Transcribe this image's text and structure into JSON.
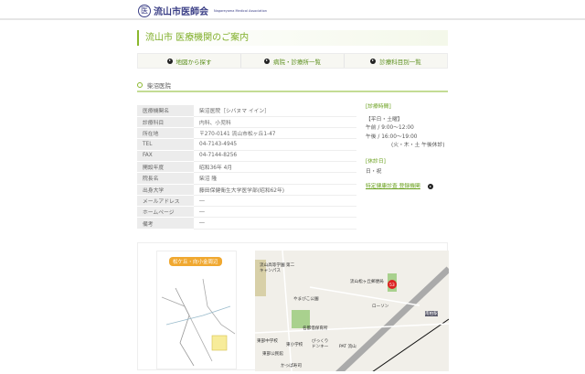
{
  "header": {
    "logo_mark": "医",
    "logo_text": "流山市医師会",
    "logo_sub": "Nagareyama Medical Association"
  },
  "page_title": "流山市 医療機関のご案内",
  "nav": [
    {
      "label": "地図から探す"
    },
    {
      "label": "病院・診療所一覧"
    },
    {
      "label": "診療科目別一覧"
    }
  ],
  "clinic_name": "柴沼医院",
  "details": [
    {
      "k": "医療機関名",
      "v": "柴沼医院［シバヌマ イイン］"
    },
    {
      "k": "診療科目",
      "v": "内科、小児科"
    },
    {
      "k": "所在地",
      "v": "〒270-0141 流山市松ヶ丘1-47"
    },
    {
      "k": "TEL",
      "v": "04-7143-4945"
    },
    {
      "k": "FAX",
      "v": "04-7144-8256"
    },
    {
      "k": "開設年度",
      "v": "昭和36年 4月"
    },
    {
      "k": "院長名",
      "v": "柴沼 隆"
    },
    {
      "k": "出身大学",
      "v": "藤田保健衛生大学医学部(昭和62年)"
    },
    {
      "k": "メールアドレス",
      "v": "―"
    },
    {
      "k": "ホームページ",
      "v": "―"
    },
    {
      "k": "備考",
      "v": "―"
    }
  ],
  "hours": {
    "label": "[診療時間]",
    "days": "【平日・土曜】",
    "am": "午前 / 9:00〜12:00",
    "pm": "午後 / 16:00〜19:00",
    "note": "(火・木・土 午後休診)"
  },
  "holiday": {
    "label": "[休診日]",
    "value": "日・祝"
  },
  "checkup_link": "特定健康診査 登録機関",
  "map": {
    "area_tag": "松ケ丘・向小金周辺",
    "labels": [
      "流山高等学園 第二キャンパス",
      "流山松ヶ丘郵便局",
      "やまびこ公園",
      "ローソン",
      "名都借保育所",
      "東部中学校",
      "東小学校",
      "びっくりドンキー",
      "PAT 流山",
      "東部公民館",
      "かっぱ寿司",
      "南柏駅"
    ],
    "marker": "53"
  }
}
